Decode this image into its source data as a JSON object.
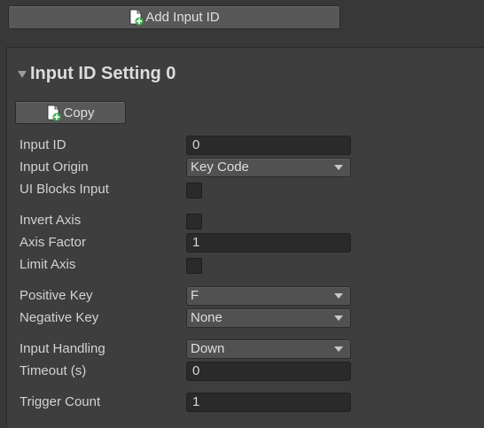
{
  "toolbar": {
    "add_button_label": "Add Input ID"
  },
  "section": {
    "title": "Input ID Setting 0",
    "copy_button_label": "Copy"
  },
  "fields": {
    "input_id": {
      "label": "Input ID",
      "value": "0"
    },
    "input_origin": {
      "label": "Input Origin",
      "value": "Key Code"
    },
    "ui_blocks_input": {
      "label": "UI Blocks Input",
      "checked": false
    },
    "invert_axis": {
      "label": "Invert Axis",
      "checked": false
    },
    "axis_factor": {
      "label": "Axis Factor",
      "value": "1"
    },
    "limit_axis": {
      "label": "Limit Axis",
      "checked": false
    },
    "positive_key": {
      "label": "Positive Key",
      "value": "F"
    },
    "negative_key": {
      "label": "Negative Key",
      "value": "None"
    },
    "input_handling": {
      "label": "Input Handling",
      "value": "Down"
    },
    "timeout": {
      "label": "Timeout (s)",
      "value": "0"
    },
    "trigger_count": {
      "label": "Trigger Count",
      "value": "1"
    }
  },
  "icons": {
    "add_doc": "document-plus-icon",
    "foldout": "foldout-arrow-icon",
    "dropdown": "chevron-down-icon"
  },
  "colors": {
    "background": "#383838",
    "panel": "#3e3e3e",
    "button": "#585858",
    "field": "#2a2a2a",
    "dropdown": "#515151",
    "plus_green": "#3fb34f"
  }
}
